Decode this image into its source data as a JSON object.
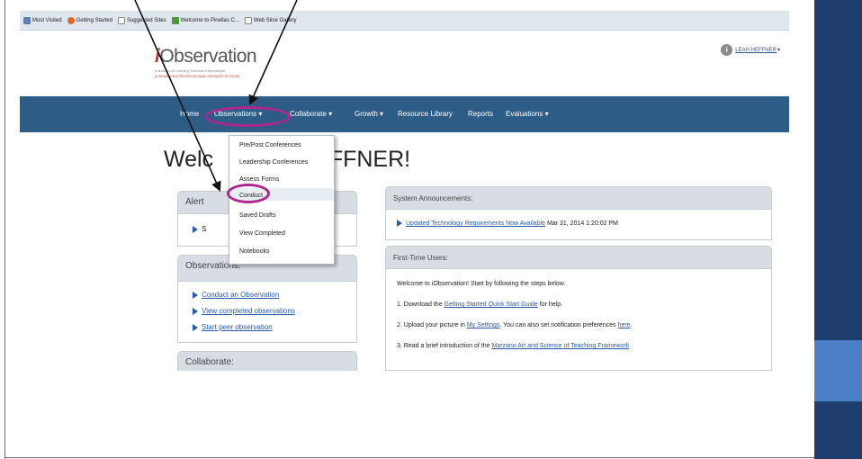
{
  "bookmarks": [
    {
      "label": "Most Visited",
      "icon": "gear-icon",
      "color": "#5a7fb5"
    },
    {
      "label": "Getting Started",
      "icon": "firefox-icon",
      "color": "#e2662b"
    },
    {
      "label": "Suggested Sites",
      "icon": "page-icon",
      "color": "#ffffff"
    },
    {
      "label": "Welcome to Pinellas C...",
      "icon": "leaf-icon",
      "color": "#4a9a3a"
    },
    {
      "label": "Web Slice Gallery",
      "icon": "page-icon",
      "color": "#ffffff"
    }
  ],
  "logo": {
    "main_prefix": "i",
    "main_rest": "Observation",
    "sub1": "a division of Learning Sciences International",
    "sub2": "A SEAMLESS PROFESSIONAL GROWTH SYSTEM"
  },
  "user": {
    "avatar_letter": "i",
    "name": "LEAH HEFFNER"
  },
  "nav": {
    "home": "Home",
    "observations": "Observations",
    "collaborate": "Collaborate",
    "growth": "Growth",
    "resource_library": "Resource Library",
    "reports": "Reports",
    "evaluations": "Evaluations"
  },
  "welcome": {
    "part1": "Welc",
    "part2": "HEFFNER!"
  },
  "dropdown_items": [
    "Pre/Post Conferences",
    "Leadership Conferences",
    "Assess Forms",
    "Conduct",
    "Saved Drafts",
    "View Completed",
    "Notebooks"
  ],
  "alerts": {
    "title": "Alert",
    "item_prefix": "S"
  },
  "observations_panel": {
    "title": "Observations:",
    "links": [
      "Conduct an Observation",
      "View completed observations",
      "Start peer observation"
    ]
  },
  "collaborate_panel": {
    "title": "Collaborate:"
  },
  "announcements": {
    "title": "System Announcements:",
    "link": "Updated Technology Requirements Now Available",
    "date": "Mar 31, 2014 1:20:02 PM"
  },
  "first_time": {
    "title": "First-Time Users:",
    "intro": "Welcome to iObservation! Start by following the steps below.",
    "step1_pre": "1.  Download the ",
    "step1_link": "Getting Started Quick Start Guide",
    "step1_post": " for help.",
    "step2_pre": "2.  Upload your picture in ",
    "step2_link": "My Settings",
    "step2_mid": ". You can also set notification preferences ",
    "step2_link2": "here",
    "step2_post": ".",
    "step3_pre": "3.  Read a brief introduction of the ",
    "step3_link": "Marzano Art and Science of Teaching Framework"
  },
  "colors": {
    "navbar": "#2d5d86",
    "highlight_ring": "#b0268e",
    "link": "#2a5aa8",
    "sidebar_dark": "#1f3d6f",
    "sidebar_light": "#4a7ec6"
  }
}
